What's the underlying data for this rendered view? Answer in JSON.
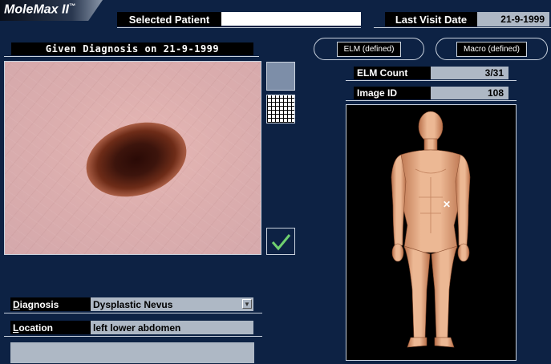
{
  "app": {
    "logo_text": "MoleMax II",
    "logo_mark": "™"
  },
  "header": {
    "selected_patient_label": "Selected Patient",
    "selected_patient_value": "",
    "last_visit_label": "Last Visit Date",
    "last_visit_value": "21-9-1999"
  },
  "image_panel": {
    "title": "Given Diagnosis on 21-9-1999"
  },
  "view_buttons": {
    "elm_label": "ELM (defined)",
    "macro_label": "Macro (defined)"
  },
  "stats": {
    "elm_count_label": "ELM Count",
    "elm_count_value": "3/31",
    "image_id_label": "Image ID",
    "image_id_value": "108"
  },
  "diagnosis": {
    "label_first": "D",
    "label_rest": "iagnosis",
    "value": "Dysplastic Nevus"
  },
  "location": {
    "label_first": "L",
    "label_rest": "ocation",
    "value": "left lower abdomen"
  },
  "body_map": {
    "marker_glyph": "✕"
  },
  "icons": {
    "confirm": "checkmark-icon",
    "dropdown": "chevron-down-icon",
    "grid": "grid-icon",
    "marker": "close-icon"
  },
  "colors": {
    "background": "#0d2244",
    "field": "#aeb8c5",
    "label": "#000000",
    "check": "#6fd06f",
    "skin": "#e2a987"
  }
}
